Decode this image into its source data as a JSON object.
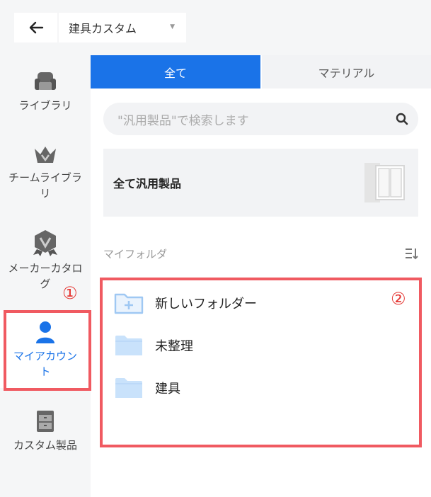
{
  "header": {
    "back_icon": "arrow-left-icon",
    "project_name": "建具カスタム",
    "dropdown_caret": "▼"
  },
  "sidebar": {
    "items": [
      {
        "label": "ライブラリ",
        "icon": "sofa-icon"
      },
      {
        "label": "チームライブラリ",
        "icon": "crown-icon"
      },
      {
        "label": "メーカーカタログ",
        "icon": "badge-v-icon"
      },
      {
        "label": "マイアカウント",
        "icon": "user-icon",
        "active": true
      },
      {
        "label": "カスタム製品",
        "icon": "cabinet-icon"
      }
    ]
  },
  "tabs": [
    {
      "label": "全て",
      "active": true
    },
    {
      "label": "マテリアル",
      "active": false
    }
  ],
  "search": {
    "placeholder": "\"汎用製品\"で検索します",
    "icon": "search-icon"
  },
  "generic_card": {
    "title": "全て汎用製品",
    "image": "door-icon"
  },
  "folders": {
    "header_label": "マイフォルダ",
    "sort_icon": "sort-icon",
    "items": [
      {
        "label": "新しいフォルダー",
        "icon": "new-folder-icon"
      },
      {
        "label": "未整理",
        "icon": "folder-icon"
      },
      {
        "label": "建具",
        "icon": "folder-icon"
      }
    ]
  },
  "annotations": {
    "marker_1": "①",
    "marker_2": "②",
    "color": "#f05a61"
  },
  "colors": {
    "accent": "#1a73e8",
    "folder": "#c9e2fb"
  }
}
